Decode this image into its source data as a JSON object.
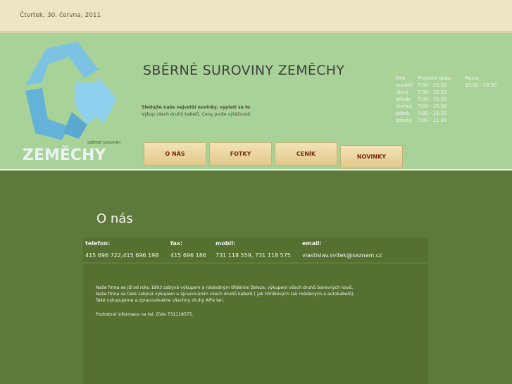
{
  "date": "Čtvrtek, 30. června, 2011",
  "site_title": "SBĚRNÉ SUROVINY ZEMĚCHY",
  "logo": {
    "small": "SBĚRNÉ SUROVINY",
    "brand": "ZEMĚCHY"
  },
  "news": {
    "line1_bold": "Sledujte naše nejvetší novinky, vyplatí se to",
    "line2": "Výkup všech druhů kabelů. Ceny podle výtěžnosti."
  },
  "hours": {
    "headers": [
      "Den",
      "Provozní doba",
      "Pauza"
    ],
    "rows": [
      {
        "day": "pondělí",
        "time": "7:00 - 15:30",
        "pause": "10:00 - 10:30"
      },
      {
        "day": "úterý",
        "time": "7:00 - 15:30",
        "pause": ""
      },
      {
        "day": "středa",
        "time": "7:00 - 15:30",
        "pause": ""
      },
      {
        "day": "čtvrtek",
        "time": "7:00 - 15:30",
        "pause": ""
      },
      {
        "day": "pátek",
        "time": "7:00 - 15:30",
        "pause": ""
      },
      {
        "day": "sobota",
        "time": "7:00 - 11:30",
        "pause": ""
      }
    ]
  },
  "nav": [
    "O NÁS",
    "FOTKY",
    "CENÍK",
    "NOVINKY"
  ],
  "page_title": "O nás",
  "contact": {
    "telefon_label": "telefon:",
    "telefon": "415 696 722,415 696 198",
    "fax_label": "fax:",
    "fax": "415 696 186",
    "mobil_label": "mobil:",
    "mobil": "731 118 559, 731 118 575",
    "email_label": "email:",
    "email": "vlastislav.svitek@seznam.cz"
  },
  "content": {
    "p1": "Naše firma se již od roku 1993 zabývá výkupem a následným tříděním železa, výkupem všech druhů barevných kovů.",
    "p2": "Naše firma se také zabývá výkupem a zpracováním všech druhů kabelů ( jak hliníkových tak měděných a autokabelů).",
    "p3": "Také vykupujeme a zpracováváme všechny druhy AlFe lan.",
    "p4": "Podrobné informace na tel. čísle 731118575."
  }
}
